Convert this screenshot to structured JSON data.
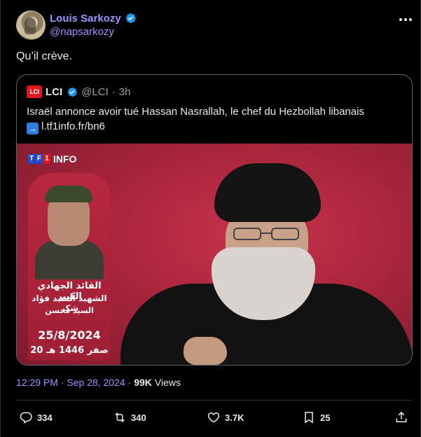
{
  "author": {
    "display_name": "Louis Sarkozy",
    "handle": "@napsarkozy",
    "verified_icon": "verified-badge-icon"
  },
  "tweet": {
    "text": "Qu’il crève."
  },
  "quote": {
    "logo_text": "LCI",
    "name": "LCI",
    "handle": "@LCI",
    "separator": "·",
    "time": "3h",
    "text_line1": "Israël annonce avoir tué Hassan Nasrallah, le chef du Hezbollah libanais",
    "link_icon": "➡️",
    "link": "l.tf1info.fr/bn6",
    "media": {
      "brand": "INFO",
      "brand_boxes": [
        "T",
        "F",
        "1"
      ],
      "poster_line1": "القائد الجهادي الكبير",
      "poster_line2": "الشهيد السيد فؤاد شكر",
      "poster_line3": "السيد محسن",
      "poster_date": "25/8/2024",
      "poster_hijri": "20 صفر 1446 هـ"
    }
  },
  "meta": {
    "time": "12:29 PM · Sep 28, 2024 ·",
    "views_count": "99K",
    "views_label": "Views"
  },
  "actions": {
    "replies": "334",
    "reposts": "340",
    "likes": "3.7K",
    "bookmarks": "25"
  },
  "colors": {
    "accent": "#9a95ff",
    "lci_red": "#e0161c",
    "background": "#000000"
  }
}
